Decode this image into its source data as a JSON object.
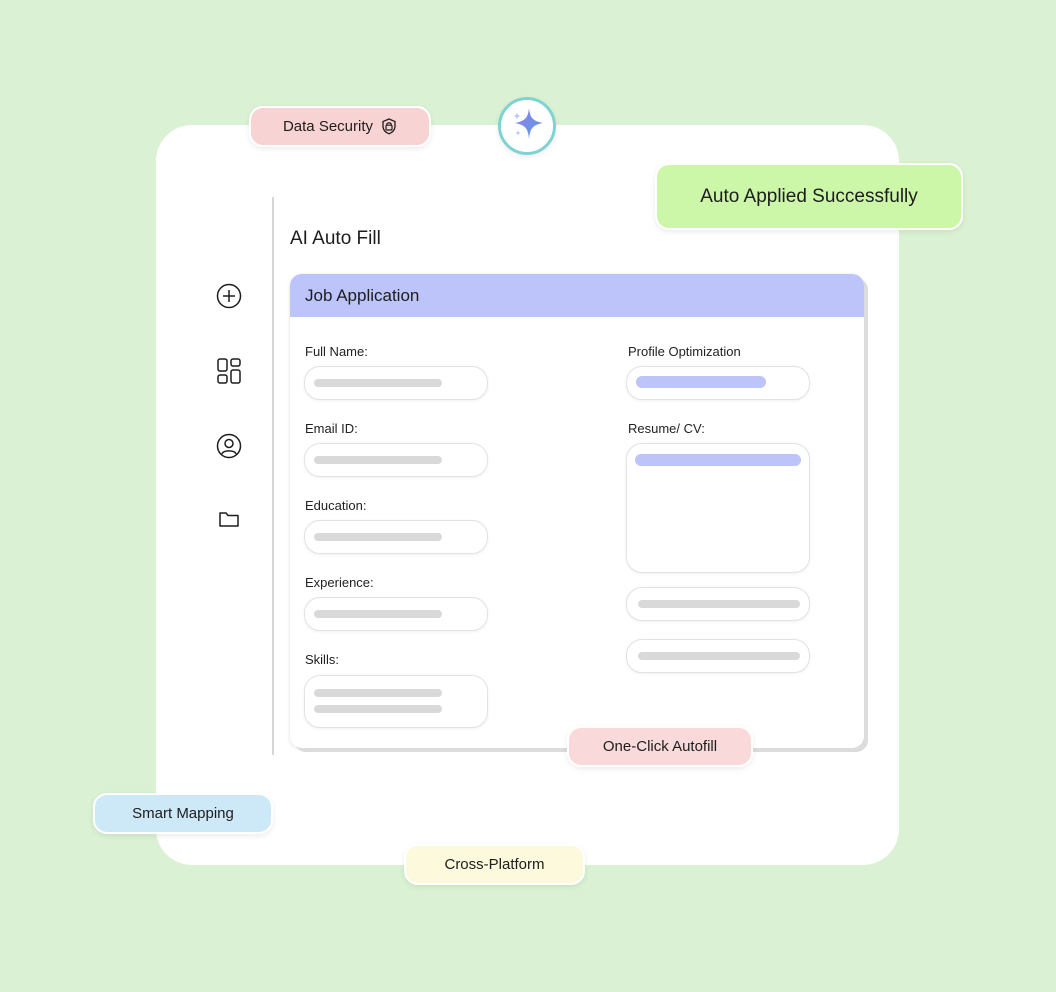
{
  "badges": {
    "data_security": "Data Security",
    "auto_applied": "Auto Applied Successfully",
    "one_click": "One-Click Autofill",
    "smart_mapping": "Smart Mapping",
    "cross_platform": "Cross-Platform"
  },
  "page": {
    "title": "AI Auto Fill"
  },
  "sidebar": {
    "icons": [
      "plus-circle-icon",
      "grid-icon",
      "user-circle-icon",
      "folder-icon"
    ]
  },
  "form": {
    "header": "Job Application",
    "left_fields": [
      "Full Name:",
      "Email ID:",
      "Education:",
      "Experience:",
      "Skills:"
    ],
    "right_fields": [
      "Profile Optimization",
      "Resume/ CV:"
    ]
  },
  "colors": {
    "background": "#daf2d3",
    "form_header": "#bcc4fa",
    "data_security": "#f8d3d3",
    "auto_applied": "#cdf7a8",
    "one_click": "#f9d9da",
    "smart_mapping": "#cde9f8",
    "cross_platform": "#fcf9dc"
  }
}
